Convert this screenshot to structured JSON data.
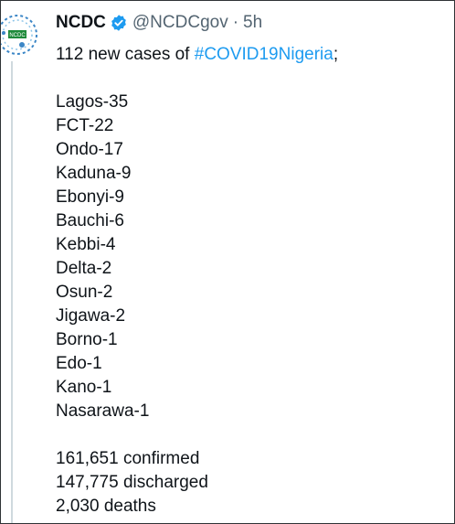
{
  "tweet": {
    "author_name": "NCDC",
    "handle": "@NCDCgov",
    "separator": "·",
    "time": "5h",
    "avatar_text": "NCDC",
    "intro_prefix": "112 new cases of ",
    "hashtag": "#COVID19Nigeria",
    "intro_suffix": ";",
    "states": [
      "Lagos-35",
      "FCT-22",
      "Ondo-17",
      "Kaduna-9",
      "Ebonyi-9",
      "Bauchi-6",
      "Kebbi-4",
      "Delta-2",
      "Osun-2",
      "Jigawa-2",
      "Borno-1",
      "Edo-1",
      "Kano-1",
      "Nasarawa-1"
    ],
    "totals": {
      "confirmed": "161,651 confirmed",
      "discharged": "147,775 discharged",
      "deaths": "2,030 deaths"
    }
  },
  "colors": {
    "text": "#0f1419",
    "secondary": "#536471",
    "link": "#1d9bf0",
    "verified": "#1d9bf0",
    "logo_green": "#1f8a3a"
  }
}
